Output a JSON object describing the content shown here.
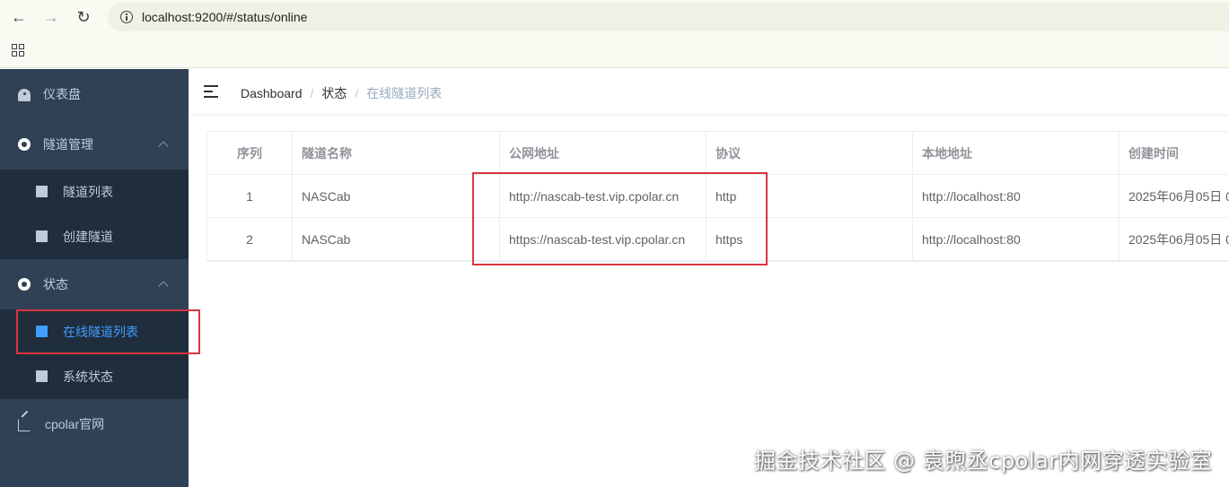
{
  "browser": {
    "url": "localhost:9200/#/status/online"
  },
  "sidebar": {
    "items": [
      {
        "label": "仪表盘",
        "icon": "dashboard-icon"
      },
      {
        "label": "隧道管理",
        "icon": "circle-icon",
        "expanded": true,
        "children": [
          {
            "label": "隧道列表",
            "icon": "table-icon"
          },
          {
            "label": "创建隧道",
            "icon": "table-icon"
          }
        ]
      },
      {
        "label": "状态",
        "icon": "circle-icon",
        "expanded": true,
        "children": [
          {
            "label": "在线隧道列表",
            "icon": "table-icon",
            "active": true
          },
          {
            "label": "系统状态",
            "icon": "table-icon"
          }
        ]
      },
      {
        "label": "cpolar官网",
        "icon": "external-link-icon"
      }
    ]
  },
  "breadcrumb": [
    "Dashboard",
    "状态",
    "在线隧道列表"
  ],
  "table": {
    "headers": [
      "序列",
      "隧道名称",
      "公网地址",
      "协议",
      "本地地址",
      "创建时间"
    ],
    "rows": [
      [
        "1",
        "NASCab",
        "http://nascab-test.vip.cpolar.cn",
        "http",
        "http://localhost:80",
        "2025年06月05日 0"
      ],
      [
        "2",
        "NASCab",
        "https://nascab-test.vip.cpolar.cn",
        "https",
        "http://localhost:80",
        "2025年06月05日 0"
      ]
    ]
  },
  "watermark": "掘金技术社区 @ 袁煦丞cpolar内网穿透实验室",
  "colors": {
    "sidebar_bg": "#304156",
    "submenu_bg": "#1f2d3d",
    "active": "#409eff",
    "highlight": "#d9363e"
  }
}
